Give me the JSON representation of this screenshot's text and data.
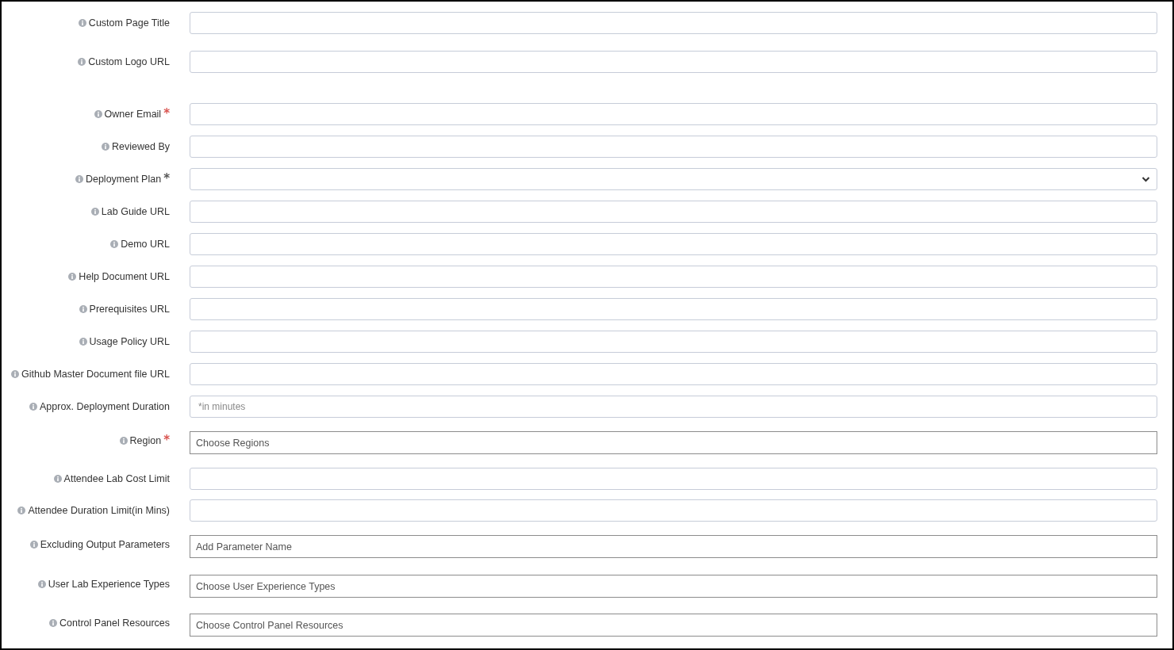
{
  "fields": [
    {
      "label": "Custom Page Title",
      "kind": "text"
    },
    {
      "label": "Custom Logo URL",
      "kind": "text"
    },
    {
      "label": "Owner Email",
      "kind": "text",
      "mark": {
        "text": "*",
        "color": "#d9534f"
      }
    },
    {
      "label": "Reviewed By",
      "kind": "text"
    },
    {
      "label": "Deployment Plan",
      "kind": "select",
      "mark": {
        "text": "*",
        "color": "#555555"
      }
    },
    {
      "label": "Lab Guide URL",
      "kind": "text"
    },
    {
      "label": "Demo URL",
      "kind": "text"
    },
    {
      "label": "Help Document URL",
      "kind": "text"
    },
    {
      "label": "Prerequisites URL",
      "kind": "text"
    },
    {
      "label": "Usage Policy URL",
      "kind": "text"
    },
    {
      "label": "Github Master Document file URL",
      "kind": "text"
    },
    {
      "label": "Approx. Deployment Duration",
      "kind": "text",
      "placeholder": "*in minutes"
    },
    {
      "label": "Region",
      "kind": "multiselect",
      "mark": {
        "text": "*",
        "color": "#d9534f"
      },
      "placeholder": "Choose Regions"
    },
    {
      "label": "Attendee Lab Cost Limit",
      "kind": "text"
    },
    {
      "label": "Attendee Duration Limit(in Mins)",
      "kind": "text"
    },
    {
      "label": "Excluding Output Parameters",
      "kind": "multiselect",
      "placeholder": "Add Parameter Name"
    },
    {
      "label": "User Lab Experience Types",
      "kind": "multiselect",
      "placeholder": "Choose User Experience Types"
    },
    {
      "label": "Control Panel Resources",
      "kind": "multiselect",
      "placeholder": "Choose Control Panel Resources"
    }
  ]
}
